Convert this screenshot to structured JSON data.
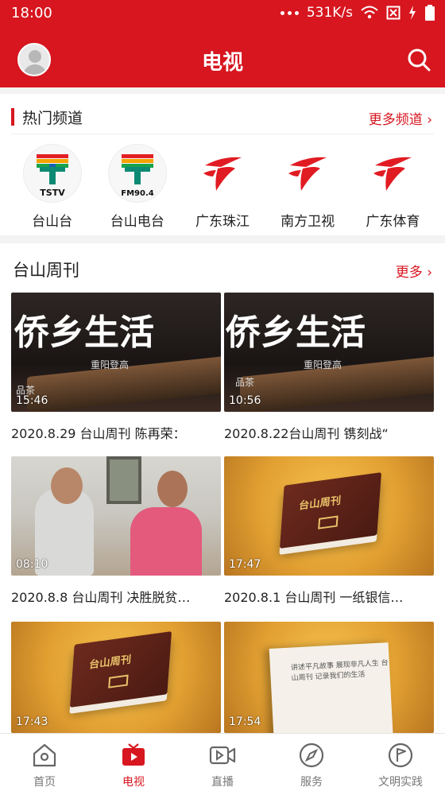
{
  "status": {
    "time": "18:00",
    "speed": "531K/s"
  },
  "header": {
    "title": "电视"
  },
  "hot": {
    "title": "热门频道",
    "more": "更多频道",
    "channels": [
      {
        "name": "台山台",
        "logo_text": "TSTV"
      },
      {
        "name": "台山电台",
        "logo_text": "FM90.4"
      },
      {
        "name": "广东珠江"
      },
      {
        "name": "南方卫视"
      },
      {
        "name": "广东体育"
      }
    ]
  },
  "weekly": {
    "title": "台山周刊",
    "more": "更多",
    "items": [
      {
        "duration": "15:46",
        "caption": "2020.8.29 台山周刊 陈再荣：",
        "overlay": "侨乡生活",
        "sub": "重阳登高",
        "corner": "品茶"
      },
      {
        "duration": "10:56",
        "caption": "2020.8.22台山周刊 镌刻战“",
        "overlay": "侨乡生活",
        "sub": "重阳登高",
        "corner": "品茶"
      },
      {
        "duration": "08:10",
        "caption": "2020.8.8 台山周刊 决胜脱贫…"
      },
      {
        "duration": "17:47",
        "caption": "2020.8.1 台山周刊 一纸银信…",
        "book_text": "台山周刊"
      },
      {
        "duration": "17:43",
        "book_text": "台山周刊"
      },
      {
        "duration": "17:54",
        "paper_text": "讲述平凡故事 展现非凡人生 台山周刊 记录我们的生活"
      }
    ]
  },
  "nav": [
    {
      "label": "首页",
      "icon": "home-icon"
    },
    {
      "label": "电视",
      "icon": "tv-icon",
      "active": true
    },
    {
      "label": "直播",
      "icon": "live-video-icon"
    },
    {
      "label": "服务",
      "icon": "compass-icon"
    },
    {
      "label": "文明实践",
      "icon": "flag-circle-icon"
    }
  ],
  "colors": {
    "brand": "#d7161f"
  }
}
